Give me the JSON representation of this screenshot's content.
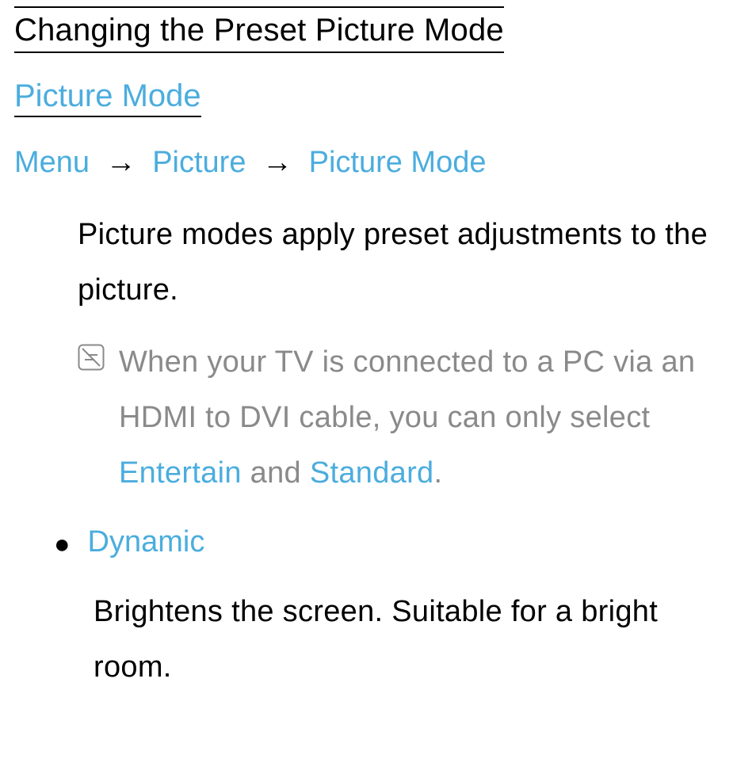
{
  "title": "Changing the Preset Picture Mode",
  "section_title": "Picture Mode",
  "breadcrumb": {
    "step1": "Menu",
    "step2": "Picture",
    "step3": "Picture Mode",
    "arrow": "→"
  },
  "intro": "Picture modes apply preset adjustments to the picture.",
  "note": {
    "prefix": "When your TV is connected to a PC via an HDMI to DVI cable, you can only select ",
    "term1": "Entertain",
    "middle": " and ",
    "term2": "Standard",
    "suffix": "."
  },
  "option": {
    "name": "Dynamic",
    "description": "Brightens the screen. Suitable for a bright room."
  },
  "bullet": "●"
}
